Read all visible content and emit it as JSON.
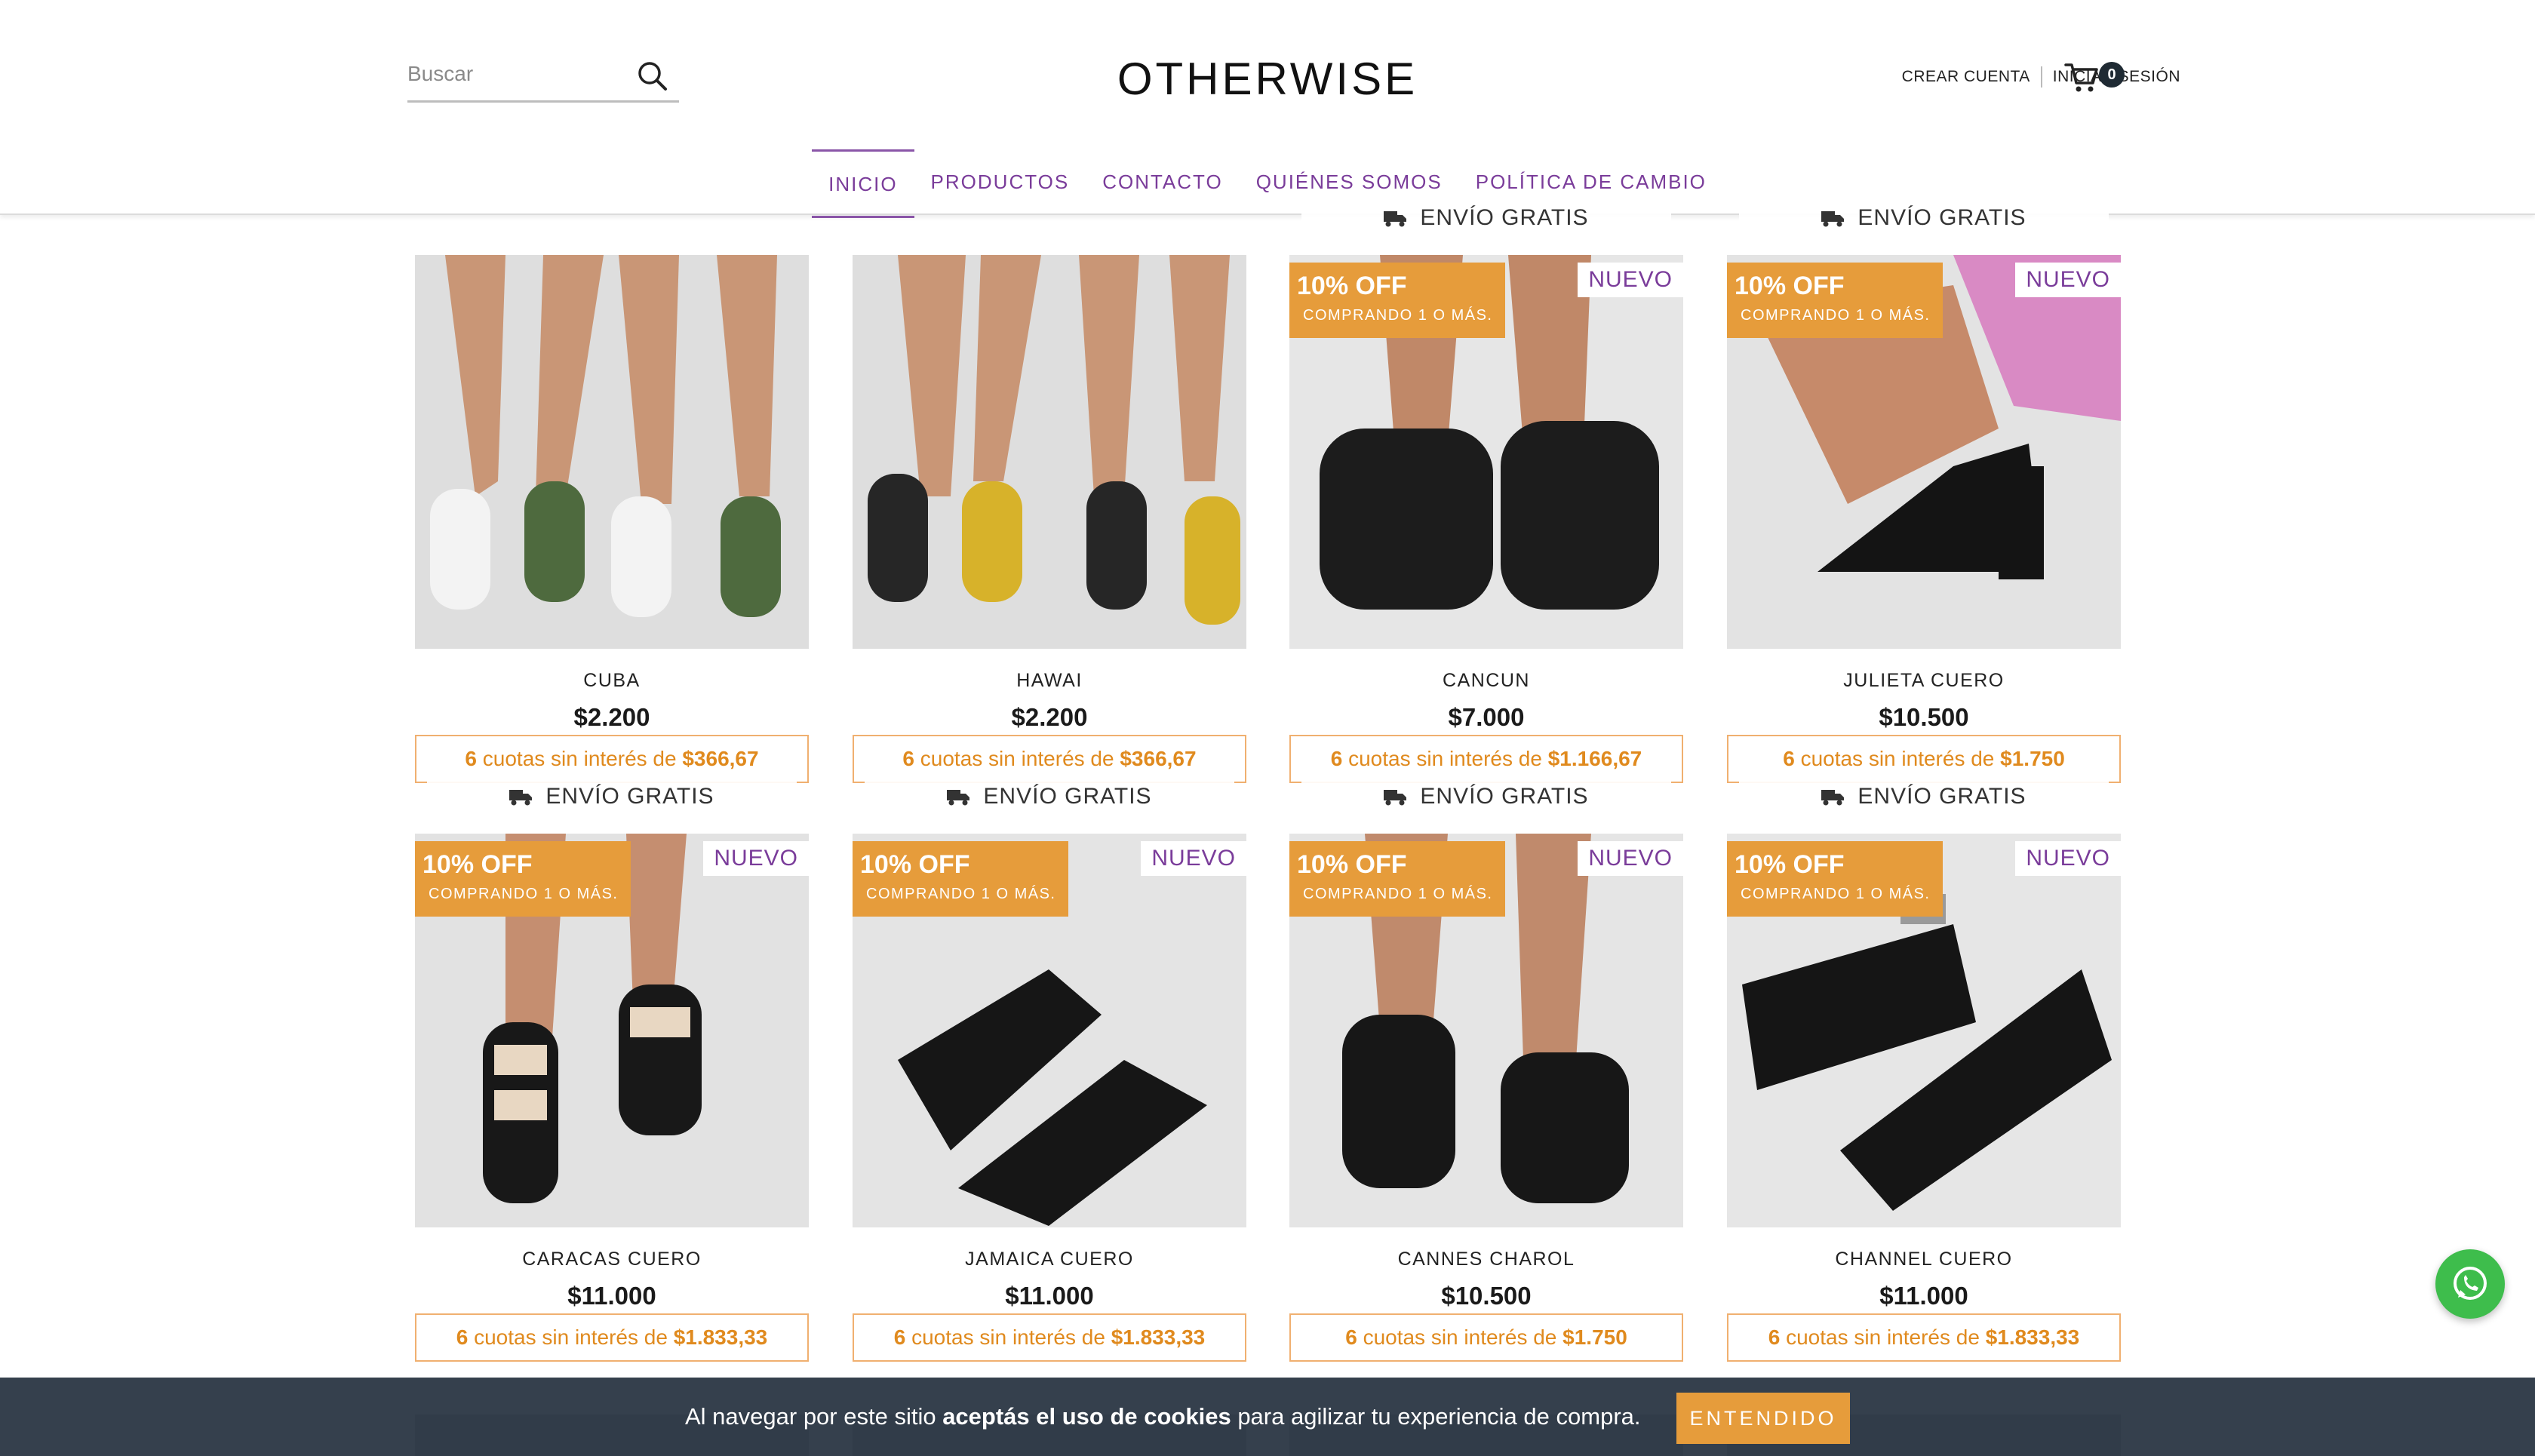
{
  "header": {
    "search_placeholder": "Buscar",
    "logo": "OTHERWISE",
    "create_account": "CREAR CUENTA",
    "login": "INICIAR SESIÓN",
    "cart_count": "0"
  },
  "nav": [
    "INICIO",
    "PRODUCTOS",
    "CONTACTO",
    "QUIÉNES SOMOS",
    "POLÍTICA DE CAMBIO"
  ],
  "labels": {
    "promo_big": "10% OFF",
    "promo_small": "COMPRANDO 1 O MÁS.",
    "nuevo": "NUEVO",
    "envio": "ENVÍO GRATIS",
    "cuotas_mid": "cuotas sin interés de"
  },
  "products": [
    {
      "name": "CUBA",
      "price": "$2.200",
      "cuotas_n": "6",
      "cuota": "$366,67",
      "promo": false,
      "nuevo": false,
      "envio": false
    },
    {
      "name": "HAWAI",
      "price": "$2.200",
      "cuotas_n": "6",
      "cuota": "$366,67",
      "promo": false,
      "nuevo": false,
      "envio": false
    },
    {
      "name": "CANCUN",
      "price": "$7.000",
      "cuotas_n": "6",
      "cuota": "$1.166,67",
      "promo": true,
      "nuevo": true,
      "envio": true
    },
    {
      "name": "JULIETA CUERO",
      "price": "$10.500",
      "cuotas_n": "6",
      "cuota": "$1.750",
      "promo": true,
      "nuevo": true,
      "envio": true
    },
    {
      "name": "CARACAS CUERO",
      "price": "$11.000",
      "cuotas_n": "6",
      "cuota": "$1.833,33",
      "promo": true,
      "nuevo": true,
      "envio": true
    },
    {
      "name": "JAMAICA CUERO",
      "price": "$11.000",
      "cuotas_n": "6",
      "cuota": "$1.833,33",
      "promo": true,
      "nuevo": true,
      "envio": true
    },
    {
      "name": "CANNES CHAROL",
      "price": "$10.500",
      "cuotas_n": "6",
      "cuota": "$1.750",
      "promo": true,
      "nuevo": true,
      "envio": true
    },
    {
      "name": "CHANNEL CUERO",
      "price": "$11.000",
      "cuotas_n": "6",
      "cuota": "$1.833,33",
      "promo": true,
      "nuevo": true,
      "envio": true
    }
  ],
  "cookie": {
    "pre": "Al navegar por este sitio ",
    "bold": "aceptás el uso de cookies",
    "post": " para agilizar tu experiencia de compra.",
    "button": "ENTENDIDO"
  },
  "icons": {
    "search": "search-icon",
    "cart": "cart-icon",
    "truck": "truck-icon",
    "whatsapp": "whatsapp-icon"
  },
  "colors": {
    "accent_purple": "#7a3c9a",
    "promo_orange": "#e69c3b",
    "cookie_bar": "#283442",
    "whatsapp_green": "#3ebd4c"
  }
}
